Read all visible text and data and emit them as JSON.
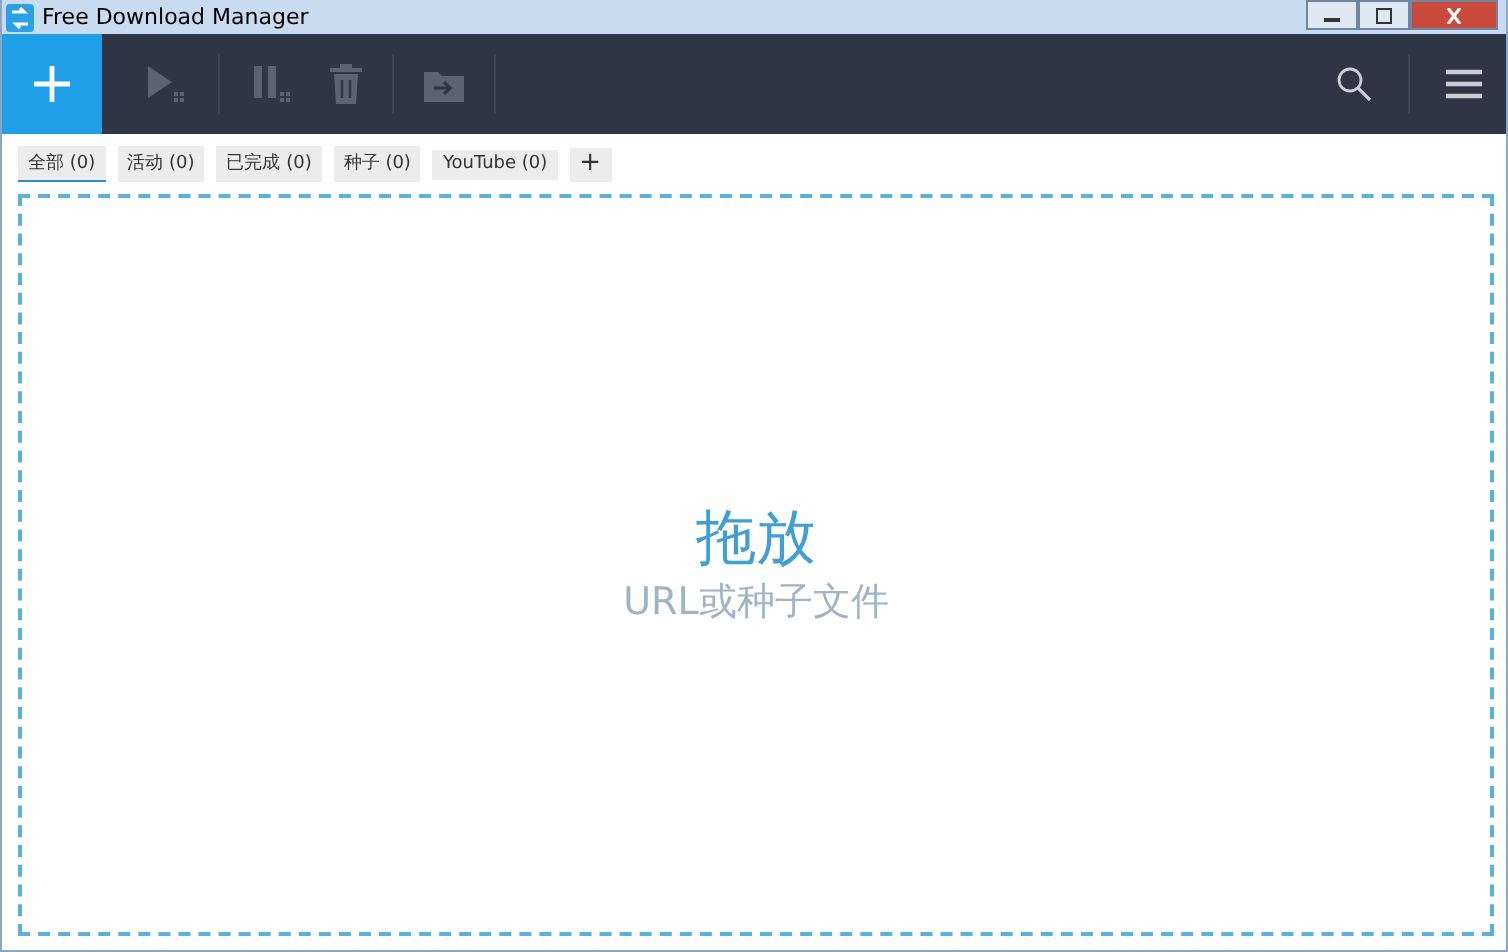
{
  "window": {
    "title": "Free Download Manager"
  },
  "toolbar": [
    {
      "kind": "add",
      "disabled": false
    },
    {
      "kind": "play",
      "disabled": true
    },
    {
      "kind": "pause",
      "disabled": true
    },
    {
      "kind": "delete",
      "disabled": true
    },
    {
      "kind": "move",
      "disabled": true
    }
  ],
  "tabs": [
    {
      "label": "全部 (0)",
      "selected": true
    },
    {
      "label": "活动 (0)",
      "selected": false
    },
    {
      "label": "已完成 (0)",
      "selected": false
    },
    {
      "label": "种子 (0)",
      "selected": false
    },
    {
      "label": "YouTube (0)",
      "selected": false
    }
  ],
  "add_tab": "+",
  "drop_zone": {
    "title": "拖放",
    "subtitle": "URL或种子文件"
  }
}
